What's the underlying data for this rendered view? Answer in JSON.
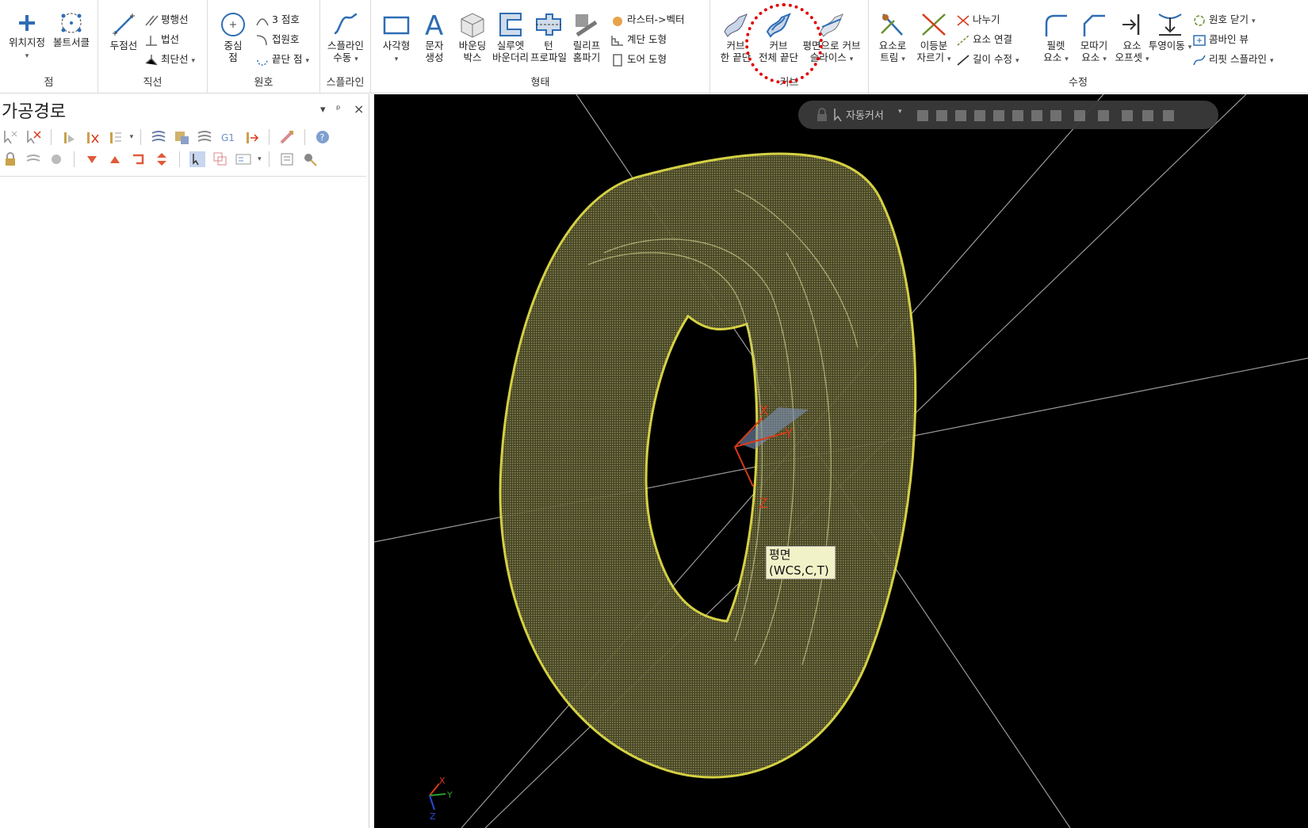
{
  "ribbon": {
    "groups": {
      "point": {
        "label": "점",
        "items": [
          "위치지정",
          "볼트서클"
        ]
      },
      "line": {
        "label": "직선",
        "big": "두점선",
        "small": [
          "평행선",
          "법선",
          "최단선"
        ]
      },
      "arc": {
        "label": "원호",
        "big": [
          "중심",
          "점"
        ],
        "small": [
          "3 점호",
          "접원호",
          "끝단 점"
        ]
      },
      "spline": {
        "label": "스플라인",
        "big": [
          "스플라인",
          "수동"
        ]
      },
      "shape": {
        "label": "형태",
        "big": [
          [
            "사각형",
            ""
          ],
          [
            "문자",
            "생성"
          ],
          [
            "바운딩",
            "박스"
          ],
          [
            "실루엣",
            "바운더리"
          ],
          [
            "턴",
            "프로파일"
          ],
          [
            "릴리프",
            "홈파기"
          ]
        ],
        "small": [
          "라스터->벡터",
          "계단 도형",
          "도어 도형"
        ]
      },
      "curve": {
        "label": "커브",
        "big": [
          [
            "커브",
            "한 끝단"
          ],
          [
            "커브",
            "전체 끝단"
          ],
          [
            "평면으로 커브",
            "슬라이스"
          ]
        ]
      },
      "modify": {
        "label": "수정",
        "big": [
          [
            "요소로",
            "트림"
          ],
          [
            "이등분",
            "자르기"
          ],
          [
            "필렛",
            "요소"
          ],
          [
            "모따기",
            "요소"
          ],
          [
            "요소",
            "오프셋"
          ],
          [
            "투영이동",
            ""
          ]
        ],
        "small_mid": [
          "나누기",
          "요소 연결",
          "길이 수정"
        ],
        "small_right": [
          "원호 닫기",
          "콤바인 뷰",
          "리핏 스플라인"
        ]
      }
    }
  },
  "panel": {
    "title": "가공경로",
    "buttons": {
      "dropdown": "▾",
      "pin": "ᵖ",
      "close": "×"
    }
  },
  "viewport": {
    "toolbar_label": "자동커서",
    "tooltip": {
      "line1": "평면",
      "line2": "(WCS,C,T)"
    },
    "gnomon": {
      "x": "X",
      "y": "Y",
      "z": "Z"
    }
  },
  "colors": {
    "accent": "#2e6db4",
    "highlight": "#e00000",
    "model": "#d9d64a",
    "axis_x": "#d83a1a",
    "axis_y": "#7fa8e0"
  }
}
